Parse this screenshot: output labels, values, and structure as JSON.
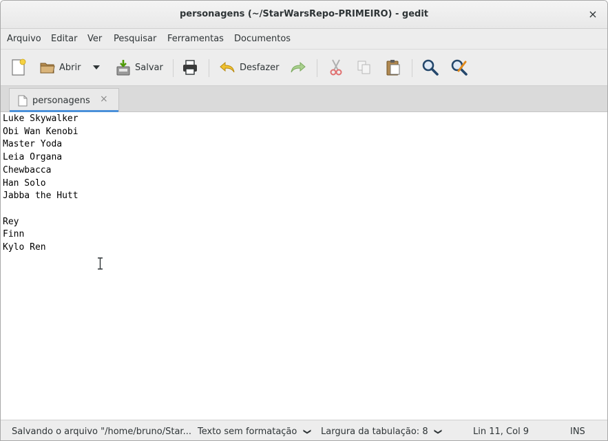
{
  "window": {
    "title": "personagens (~/StarWarsRepo-PRIMEIRO) - gedit",
    "close_glyph": "×"
  },
  "menu": [
    "Arquivo",
    "Editar",
    "Ver",
    "Pesquisar",
    "Ferramentas",
    "Documentos"
  ],
  "toolbar": {
    "open_label": "Abrir",
    "save_label": "Salvar",
    "undo_label": "Desfazer"
  },
  "tab": {
    "label": "personagens",
    "close_glyph": "×"
  },
  "editor": {
    "lines": [
      "Luke Skywalker",
      "Obi Wan Kenobi",
      "Master Yoda",
      "Leia Organa",
      "Chewbacca",
      "Han Solo",
      "Jabba the Hutt",
      "",
      "Rey",
      "Finn",
      "Kylo Ren"
    ]
  },
  "status": {
    "message": "Salvando o arquivo \"/home/bruno/Star...",
    "syntax": "Texto sem formatação",
    "tab_width": "Largura da tabulação: 8",
    "position": "Lin 11, Col 9",
    "mode": "INS"
  },
  "colors": {
    "tab_accent": "#4a90d9",
    "toolbar_bg": "#ededed",
    "editor_bg": "#ffffff"
  }
}
